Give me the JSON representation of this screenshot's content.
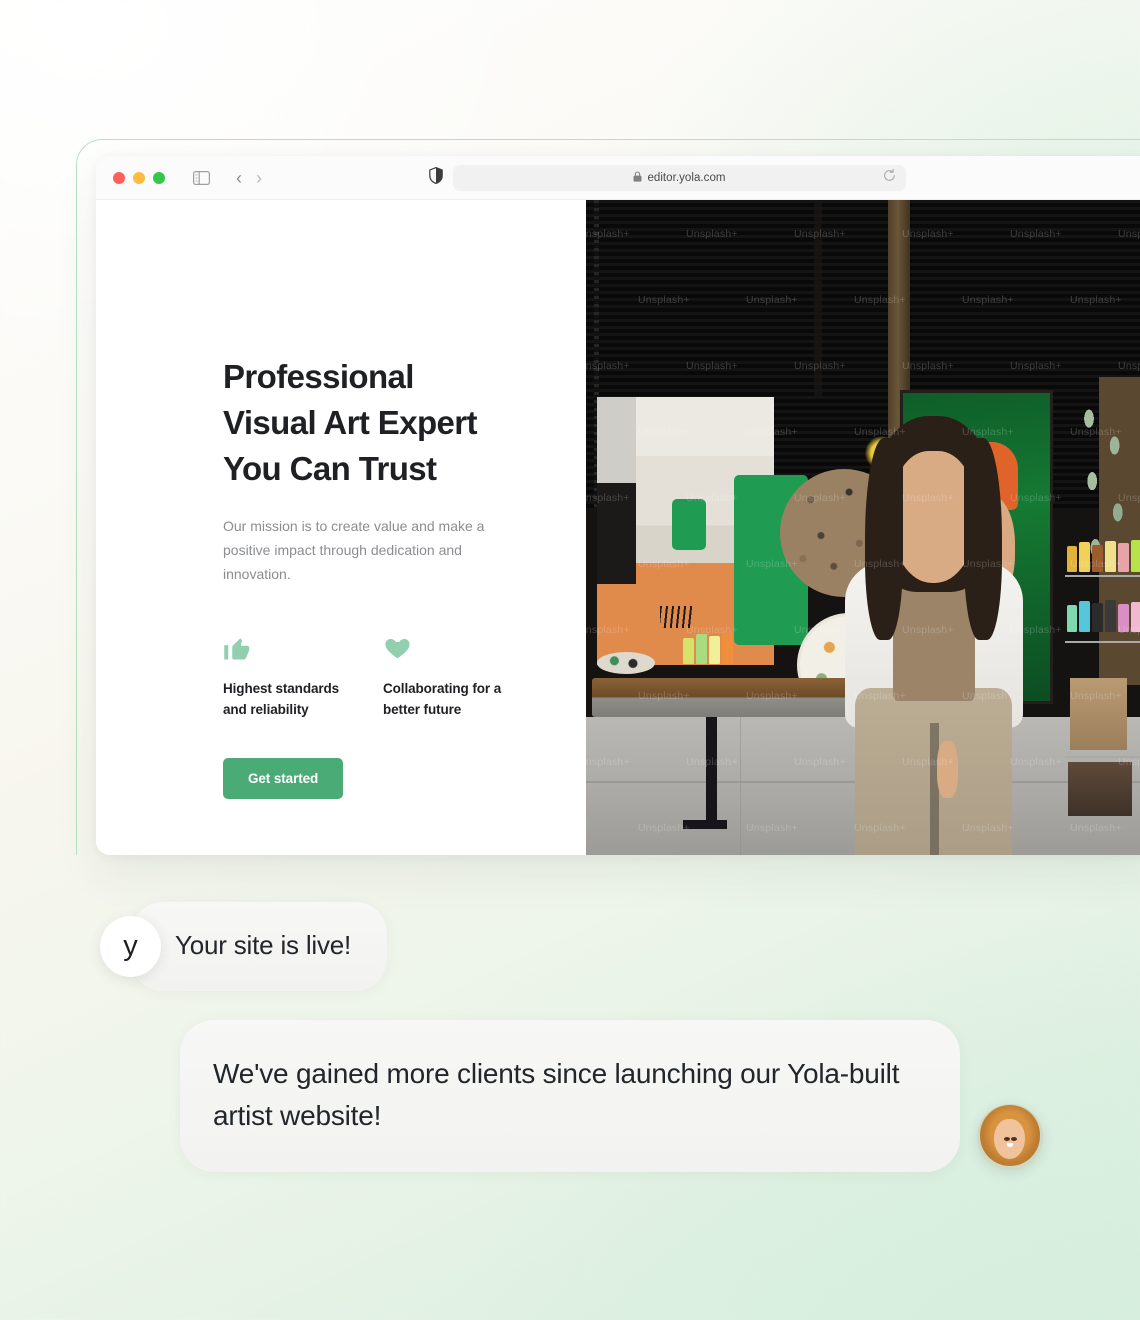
{
  "browser": {
    "traffic_lights": [
      "close",
      "minimize",
      "maximize"
    ],
    "sidebar_icon": "sidebar-toggle-icon",
    "back_label": "‹",
    "forward_label": "›",
    "shield_icon": "privacy-shield-icon",
    "lock_icon": "lock-icon",
    "url": "editor.yola.com",
    "reload_icon": "reload-icon"
  },
  "site": {
    "headline_lines": [
      "Professional",
      "Visual Art Expert",
      "You Can Trust"
    ],
    "subcopy": "Our mission is to create value and make a positive impact through dedication and innovation.",
    "features": [
      {
        "icon": "thumbs-up-icon",
        "label": "Highest standards and reliability"
      },
      {
        "icon": "heart-icon",
        "label": "Collaborating for a better future"
      }
    ],
    "cta_label": "Get started",
    "hero_image": {
      "alt": "Woman artist sitting in a paint studio surrounded by canvases and paint bottles",
      "watermark": "Unsplash+"
    }
  },
  "chat": {
    "logo_letter": "y",
    "message_1": "Your site is live!",
    "message_2": "We've gained more clients since launching our Yola-built artist website!",
    "avatar_alt": "Smiling woman with reddish-blonde hair"
  },
  "colors": {
    "accent_green": "#4aab77",
    "icon_green": "#92cfae",
    "frame_green": "#b6e2c4",
    "text_dark": "#1f2023",
    "text_muted": "#8b8d91",
    "bubble_bg": "#f5f5f3"
  }
}
